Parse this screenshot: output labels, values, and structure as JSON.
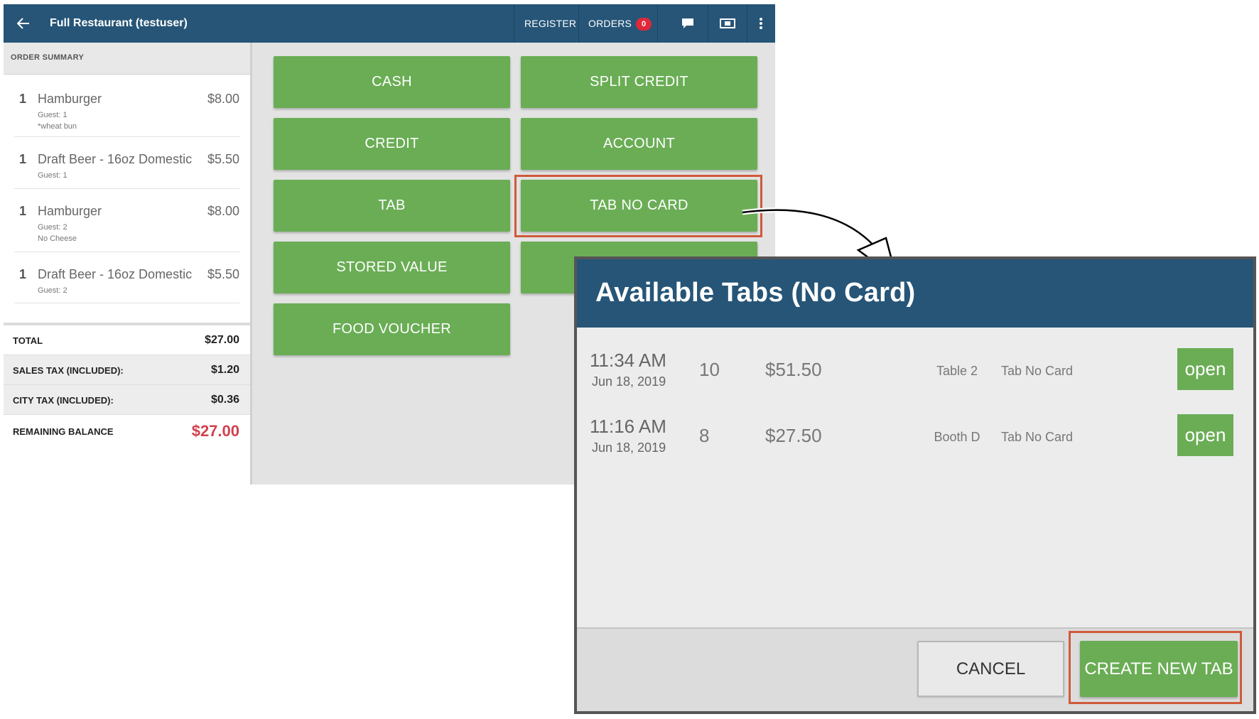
{
  "header": {
    "title": "Full Restaurant (testuser)",
    "register_label": "REGISTER",
    "orders_label": "ORDERS",
    "orders_count": "0"
  },
  "summary": {
    "title": "ORDER SUMMARY",
    "items": [
      {
        "qty": "1",
        "name": "Hamburger",
        "price": "$8.00",
        "notes": [
          "Guest: 1",
          "*wheat bun"
        ]
      },
      {
        "qty": "1",
        "name": "Draft Beer - 16oz Domestic",
        "price": "$5.50",
        "notes": [
          "Guest: 1"
        ]
      },
      {
        "qty": "1",
        "name": "Hamburger",
        "price": "$8.00",
        "notes": [
          "Guest: 2",
          "No Cheese"
        ]
      },
      {
        "qty": "1",
        "name": "Draft Beer - 16oz Domestic",
        "price": "$5.50",
        "notes": [
          "Guest: 2"
        ]
      }
    ],
    "totals": [
      {
        "label": "TOTAL",
        "value": "$27.00"
      },
      {
        "label": "SALES TAX (INCLUDED):",
        "value": "$1.20"
      },
      {
        "label": "CITY TAX (INCLUDED):",
        "value": "$0.36"
      },
      {
        "label": "REMAINING BALANCE",
        "value": "$27.00"
      }
    ]
  },
  "payments": [
    "CASH",
    "SPLIT CREDIT",
    "CREDIT",
    "ACCOUNT",
    "TAB",
    "TAB NO CARD",
    "STORED VALUE",
    "",
    "FOOD VOUCHER"
  ],
  "dialog": {
    "title": "Available Tabs (No Card)",
    "tabs": [
      {
        "time": "11:34 AM",
        "date": "Jun 18, 2019",
        "guests": "10",
        "amount": "$51.50",
        "location": "Table 2",
        "type": "Tab No Card",
        "action": "open"
      },
      {
        "time": "11:16 AM",
        "date": "Jun 18, 2019",
        "guests": "8",
        "amount": "$27.50",
        "location": "Booth D",
        "type": "Tab No Card",
        "action": "open"
      }
    ],
    "cancel_label": "CANCEL",
    "create_label": "CREATE NEW TAB"
  },
  "colors": {
    "header": "#265577",
    "button_green": "#6aad55",
    "highlight": "#cf5a3a",
    "balance_red": "#d0424e",
    "badge_red": "#e0283a"
  }
}
